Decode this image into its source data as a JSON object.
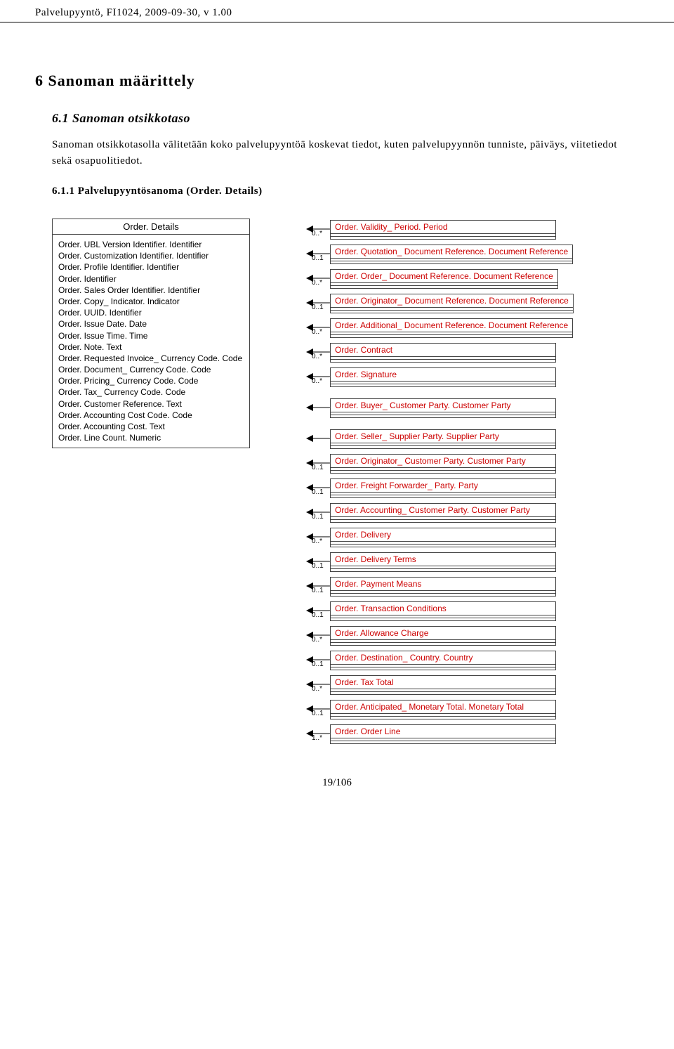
{
  "header": "Palvelupyyntö, FI1024, 2009-09-30, v 1.00",
  "h1": "6   Sanoman määrittely",
  "h2": "6.1   Sanoman otsikkotaso",
  "para": "Sanoman otsikkotasolla välitetään koko palvelupyyntöä koskevat tiedot, kuten palvelupyynnön tunniste, päiväys, viitetiedot sekä osapuolitiedot.",
  "h3": "6.1.1   Palvelupyyntösanoma (Order. Details)",
  "main": {
    "title": "Order. Details",
    "lines": [
      "Order. UBL Version Identifier. Identifier",
      "Order. Customization Identifier. Identifier",
      "Order. Profile Identifier. Identifier",
      "Order. Identifier",
      "Order. Sales Order Identifier. Identifier",
      "Order. Copy_ Indicator. Indicator",
      "Order. UUID. Identifier",
      "Order. Issue Date. Date",
      "Order. Issue Time. Time",
      "Order. Note. Text",
      "Order. Requested Invoice_ Currency Code. Code",
      "Order. Document_ Currency Code. Code",
      "Order. Pricing_ Currency Code. Code",
      "Order. Tax_ Currency Code. Code",
      "Order. Customer Reference. Text",
      "Order. Accounting Cost Code. Code",
      "Order. Accounting Cost. Text",
      "Order. Line Count. Numeric"
    ]
  },
  "relations": [
    {
      "mult": "0..*",
      "label": "Order. Validity_ Period. Period"
    },
    {
      "mult": "0..1",
      "label": "Order. Quotation_ Document Reference. Document Reference"
    },
    {
      "mult": "0..*",
      "label": "Order. Order_ Document Reference. Document Reference"
    },
    {
      "mult": "0..1",
      "label": "Order. Originator_ Document Reference. Document Reference"
    },
    {
      "mult": "0..*",
      "label": "Order. Additional_ Document Reference. Document Reference"
    },
    {
      "mult": "0..*",
      "label": "Order. Contract"
    },
    {
      "mult": "0..*",
      "label": "Order. Signature"
    },
    {
      "mult": "",
      "label": "Order. Buyer_ Customer Party. Customer Party"
    },
    {
      "mult": "",
      "label": "Order. Seller_ Supplier Party. Supplier Party"
    },
    {
      "mult": "0..1",
      "label": "Order. Originator_ Customer Party. Customer Party"
    },
    {
      "mult": "0..1",
      "label": "Order. Freight Forwarder_ Party. Party"
    },
    {
      "mult": "0..1",
      "label": "Order. Accounting_ Customer Party. Customer Party"
    },
    {
      "mult": "0..*",
      "label": "Order. Delivery"
    },
    {
      "mult": "0..1",
      "label": "Order. Delivery Terms"
    },
    {
      "mult": "0..1",
      "label": "Order. Payment Means"
    },
    {
      "mult": "0..1",
      "label": "Order. Transaction Conditions"
    },
    {
      "mult": "0..*",
      "label": "Order. Allowance Charge"
    },
    {
      "mult": "0..1",
      "label": "Order. Destination_ Country. Country"
    },
    {
      "mult": "0..*",
      "label": "Order. Tax Total"
    },
    {
      "mult": "0..1",
      "label": "Order. Anticipated_ Monetary Total. Monetary Total"
    },
    {
      "mult": "1..*",
      "label": "Order. Order Line"
    }
  ],
  "footer": "19/106"
}
